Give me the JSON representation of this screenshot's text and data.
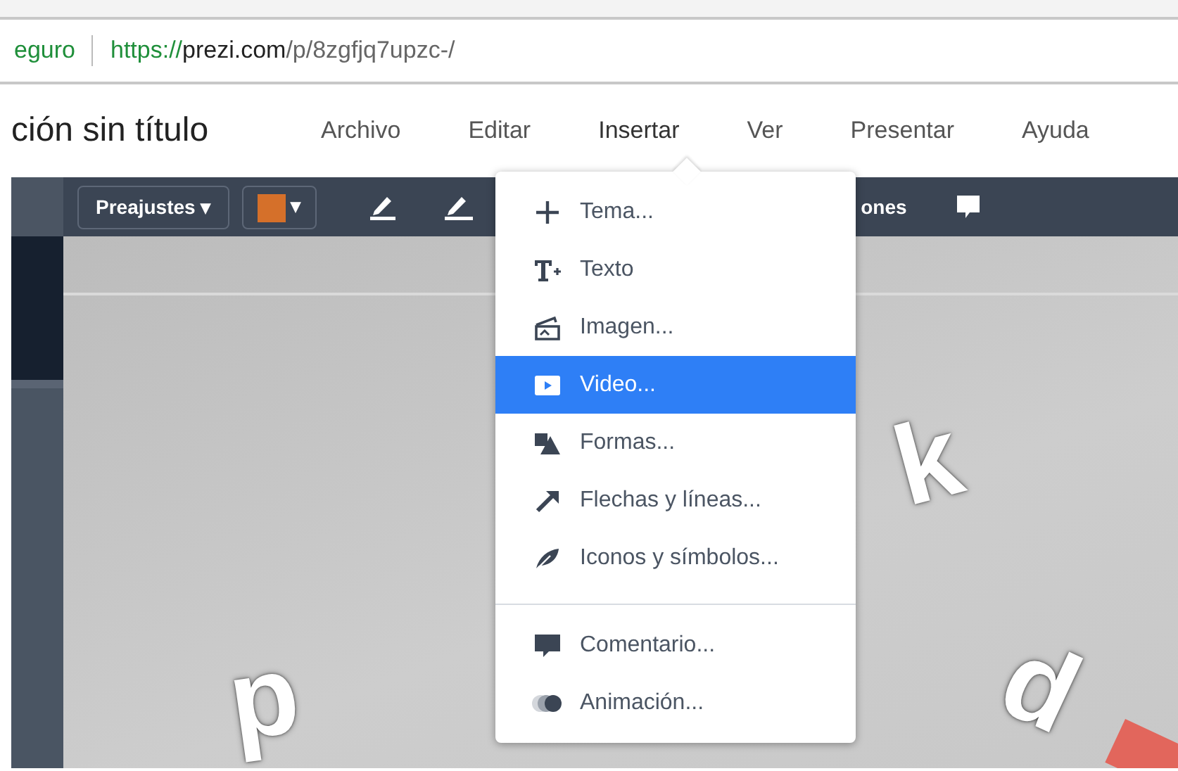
{
  "address_bar": {
    "security_label": "eguro",
    "url_scheme": "https://",
    "url_host": "prezi.com",
    "url_path": "/p/8zgfjq7upzc-/"
  },
  "app_bar": {
    "title": "ción sin título",
    "menus": [
      {
        "label": "Archivo",
        "open": false
      },
      {
        "label": "Editar",
        "open": false
      },
      {
        "label": "Insertar",
        "open": true
      },
      {
        "label": "Ver",
        "open": false
      },
      {
        "label": "Presentar",
        "open": false
      },
      {
        "label": "Ayuda",
        "open": false
      }
    ]
  },
  "toolbar": {
    "presets_button": "Preajustes ▾",
    "color_button": {
      "color": "#d5702a",
      "caret": "▾"
    },
    "partial_label": "ones"
  },
  "canvas": {
    "letters": [
      "p",
      "k",
      "d"
    ]
  },
  "insert_menu": {
    "groups": [
      [
        {
          "label": "Tema...",
          "selected": false
        },
        {
          "label": "Texto",
          "selected": false
        },
        {
          "label": "Imagen...",
          "selected": false
        },
        {
          "label": "Video...",
          "selected": true
        },
        {
          "label": "Formas...",
          "selected": false
        },
        {
          "label": "Flechas y líneas...",
          "selected": false
        },
        {
          "label": "Iconos y símbolos...",
          "selected": false
        }
      ],
      [
        {
          "label": "Comentario...",
          "selected": false
        },
        {
          "label": "Animación...",
          "selected": false
        }
      ]
    ]
  }
}
